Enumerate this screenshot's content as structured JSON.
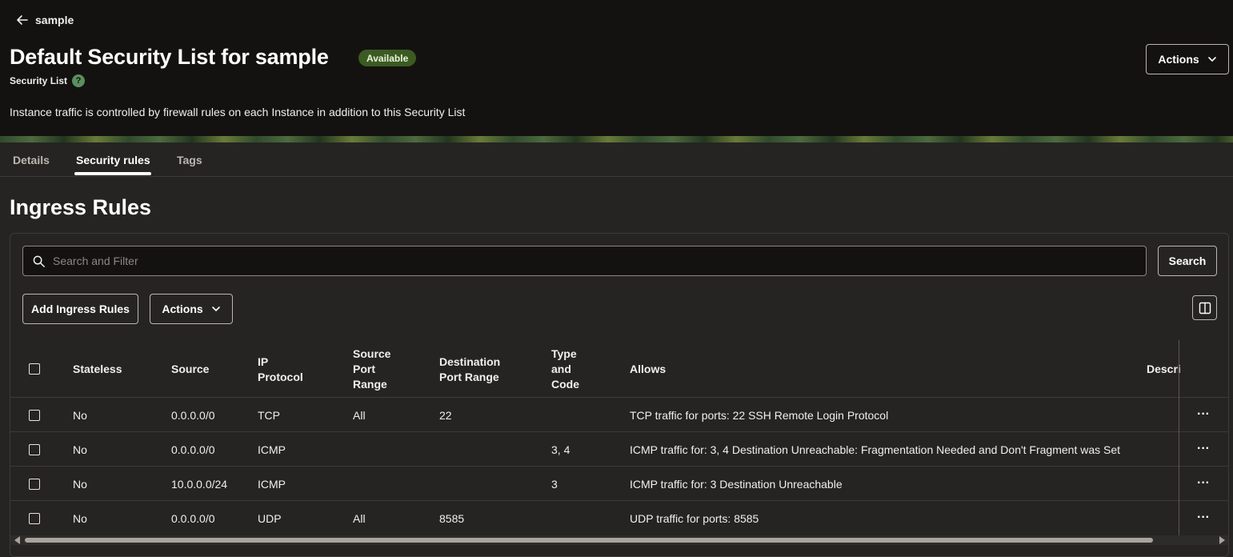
{
  "header": {
    "back_label": "sample",
    "title": "Default Security List for sample",
    "status": "Available",
    "subtitle": "Security List",
    "help": "?",
    "description": "Instance traffic is controlled by firewall rules on each Instance in addition to this Security List",
    "actions_label": "Actions"
  },
  "tabs": [
    {
      "label": "Details",
      "active": false
    },
    {
      "label": "Security rules",
      "active": true
    },
    {
      "label": "Tags",
      "active": false
    }
  ],
  "section_title": "Ingress Rules",
  "toolbar": {
    "search_placeholder": "Search and Filter",
    "search_button": "Search",
    "add_button": "Add Ingress Rules",
    "actions_label": "Actions"
  },
  "table": {
    "columns": [
      "Stateless",
      "Source",
      "IP\nProtocol",
      "Source\nPort\nRange",
      "Destination\nPort Range",
      "Type\nand\nCode",
      "Allows",
      "Descri"
    ],
    "rows": [
      {
        "stateless": "No",
        "source": "0.0.0.0/0",
        "protocol": "TCP",
        "src_port": "All",
        "dst_port": "22",
        "type_code": "",
        "allows": "TCP traffic for ports: 22 SSH Remote Login Protocol"
      },
      {
        "stateless": "No",
        "source": "0.0.0.0/0",
        "protocol": "ICMP",
        "src_port": "",
        "dst_port": "",
        "type_code": "3, 4",
        "allows": "ICMP traffic for: 3, 4 Destination Unreachable: Fragmentation Needed and Don't Fragment was Set"
      },
      {
        "stateless": "No",
        "source": "10.0.0.0/24",
        "protocol": "ICMP",
        "src_port": "",
        "dst_port": "",
        "type_code": "3",
        "allows": "ICMP traffic for: 3 Destination Unreachable"
      },
      {
        "stateless": "No",
        "source": "0.0.0.0/0",
        "protocol": "UDP",
        "src_port": "All",
        "dst_port": "8585",
        "type_code": "",
        "allows": "UDP traffic for ports: 8585"
      }
    ]
  },
  "colors": {
    "background": "#262422",
    "header": "#141211",
    "badge": "#3b5b22"
  }
}
